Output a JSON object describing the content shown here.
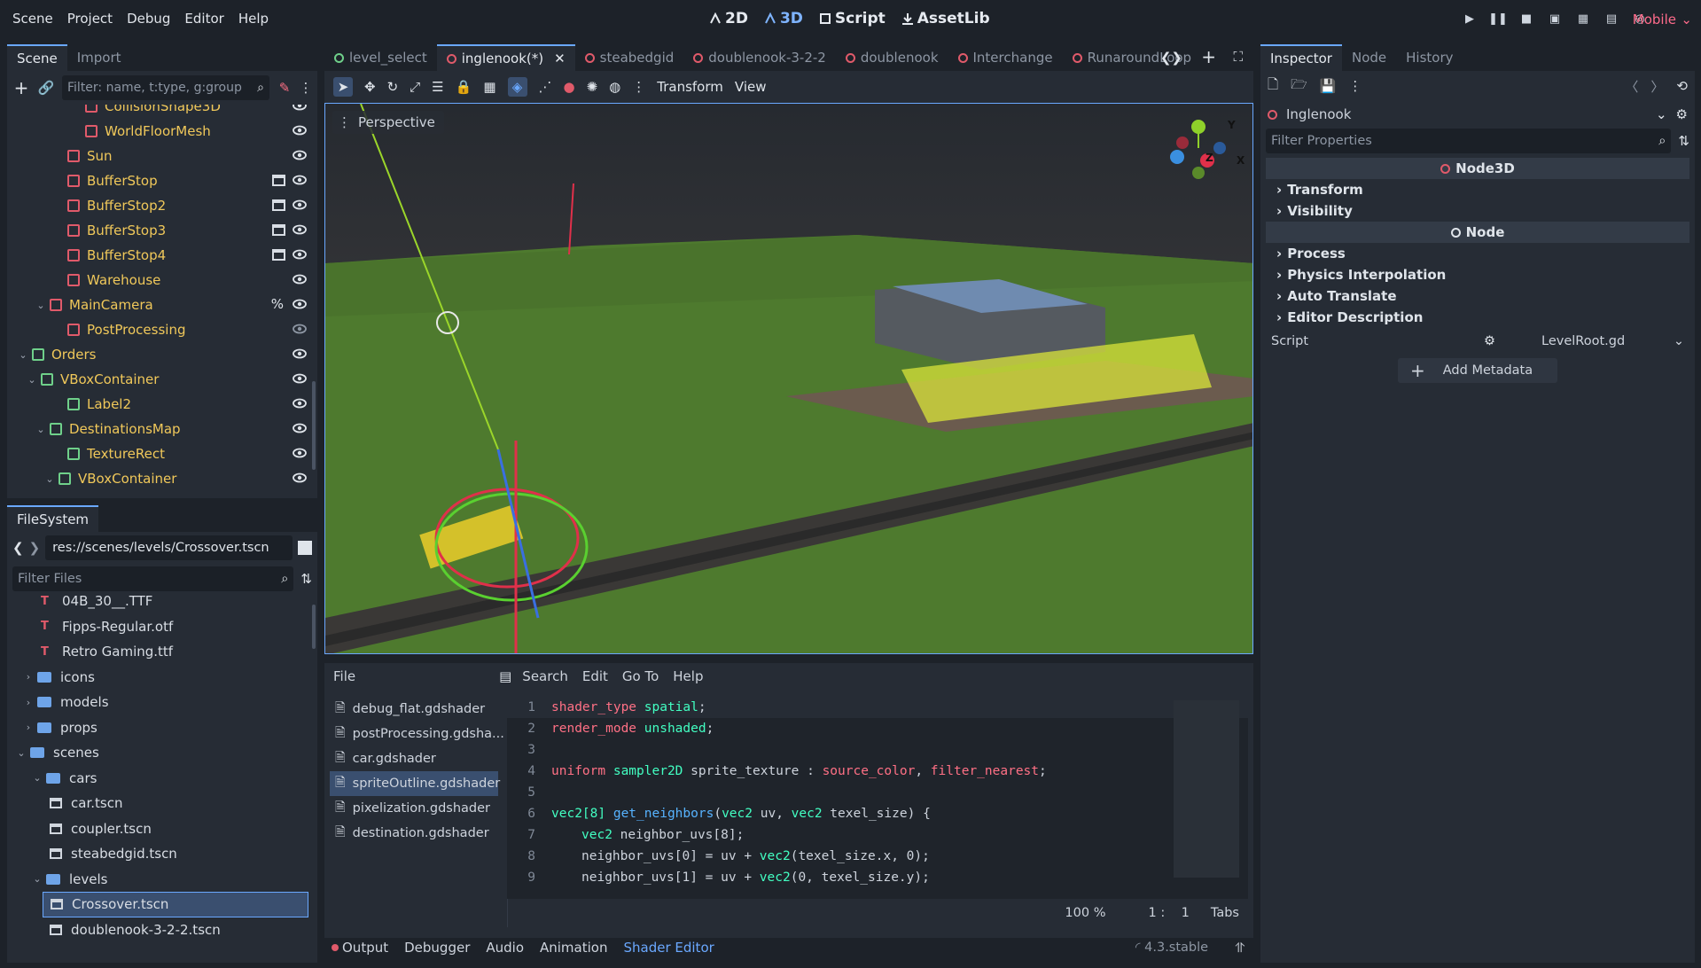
{
  "menu": [
    "Scene",
    "Project",
    "Debug",
    "Editor",
    "Help"
  ],
  "modes": [
    {
      "label": "2D"
    },
    {
      "label": "3D"
    },
    {
      "label": "Script"
    },
    {
      "label": "AssetLib"
    }
  ],
  "renderer": "Mobile",
  "scene_dock": {
    "tabs": [
      "Scene",
      "Import"
    ],
    "filter_placeholder": "Filter: name, t:type, g:group",
    "nodes": [
      {
        "label": "CollisionShape3D",
        "color": "#f0c85a"
      },
      {
        "label": "WorldFloorMesh",
        "color": "#f0c85a"
      },
      {
        "label": "Sun",
        "color": "#f0c85a"
      },
      {
        "label": "BufferStop",
        "color": "#f0c85a"
      },
      {
        "label": "BufferStop2",
        "color": "#f0c85a"
      },
      {
        "label": "BufferStop3",
        "color": "#f0c85a"
      },
      {
        "label": "BufferStop4",
        "color": "#f0c85a"
      },
      {
        "label": "Warehouse",
        "color": "#f0c85a"
      },
      {
        "label": "MainCamera",
        "color": "#f0c85a",
        "extra": "%"
      },
      {
        "label": "PostProcessing",
        "color": "#f0c85a"
      },
      {
        "label": "Orders",
        "color": "#f0c85a"
      },
      {
        "label": "VBoxContainer",
        "color": "#f0c85a"
      },
      {
        "label": "Label2",
        "color": "#f0c85a"
      },
      {
        "label": "DestinationsMap",
        "color": "#f0c85a"
      },
      {
        "label": "TextureRect",
        "color": "#f0c85a"
      },
      {
        "label": "VBoxContainer",
        "color": "#f0c85a"
      }
    ]
  },
  "filesystem": {
    "tab": "FileSystem",
    "path": "res://scenes/levels/Crossover.tscn",
    "filter_placeholder": "Filter Files",
    "items": [
      {
        "label": "04B_30__.TTF",
        "kind": "font"
      },
      {
        "label": "Fipps-Regular.otf",
        "kind": "font"
      },
      {
        "label": "Retro Gaming.ttf",
        "kind": "font"
      },
      {
        "label": "icons",
        "kind": "folder"
      },
      {
        "label": "models",
        "kind": "folder"
      },
      {
        "label": "props",
        "kind": "folder"
      },
      {
        "label": "scenes",
        "kind": "folder"
      },
      {
        "label": "cars",
        "kind": "folder"
      },
      {
        "label": "car.tscn",
        "kind": "scene"
      },
      {
        "label": "coupler.tscn",
        "kind": "scene"
      },
      {
        "label": "steabedgid.tscn",
        "kind": "scene"
      },
      {
        "label": "levels",
        "kind": "folder"
      },
      {
        "label": "Crossover.tscn",
        "kind": "scene"
      },
      {
        "label": "doublenook-3-2-2.tscn",
        "kind": "scene"
      },
      {
        "label": "doublenook.tscn",
        "kind": "scene"
      }
    ]
  },
  "scene_tabs": [
    {
      "label": "level_select"
    },
    {
      "label": "inglenook(*)"
    },
    {
      "label": "steabedgid"
    },
    {
      "label": "doublenook-3-2-2"
    },
    {
      "label": "doublenook"
    },
    {
      "label": "Interchange"
    },
    {
      "label": "RunaroundLoop"
    }
  ],
  "viewport_toolbar": {
    "transform": "Transform",
    "view": "View",
    "perspective": "Perspective"
  },
  "gizmo": {
    "y": "Y",
    "x": "X",
    "z": "Z"
  },
  "shader_editor": {
    "menu": [
      "File",
      "Search",
      "Edit",
      "Go To",
      "Help"
    ],
    "files": [
      "debug_flat.gdshader",
      "postProcessing.gdsha...",
      "car.gdshader",
      "spriteOutline.gdshader",
      "pixelization.gdshader",
      "destination.gdshader"
    ],
    "selected_file": "spriteOutline.gdshader",
    "zoom": "100 %",
    "cursor_line": "1",
    "cursor_col": "1",
    "indent": "Tabs"
  },
  "code_lines": [
    {
      "n": "1",
      "t": "shader_type spatial;"
    },
    {
      "n": "2",
      "t": "render_mode unshaded;"
    },
    {
      "n": "3",
      "t": ""
    },
    {
      "n": "4",
      "t": "uniform sampler2D sprite_texture : source_color, filter_nearest;"
    },
    {
      "n": "5",
      "t": ""
    },
    {
      "n": "6",
      "t": "vec2[8] get_neighbors(vec2 uv, vec2 texel_size) {"
    },
    {
      "n": "7",
      "t": "vec2 neighbor_uvs[8];"
    },
    {
      "n": "8",
      "t": "neighbor_uvs[0] = uv + vec2(texel_size.x, 0);"
    },
    {
      "n": "9",
      "t": "neighbor_uvs[1] = uv + vec2(0, texel_size.y);"
    }
  ],
  "bottom_tabs": [
    "Output",
    "Debugger",
    "Audio",
    "Animation",
    "Shader Editor"
  ],
  "version": "4.3.stable",
  "inspector": {
    "tabs": [
      "Inspector",
      "Node",
      "History"
    ],
    "node_name": "Inglenook",
    "filter_placeholder": "Filter Properties",
    "section_node3d": "Node3D",
    "node3d_props": [
      "Transform",
      "Visibility"
    ],
    "section_node": "Node",
    "node_props": [
      "Process",
      "Physics Interpolation",
      "Auto Translate",
      "Editor Description"
    ],
    "script_label": "Script",
    "script_value": "LevelRoot.gd",
    "add_metadata": "Add Metadata"
  }
}
